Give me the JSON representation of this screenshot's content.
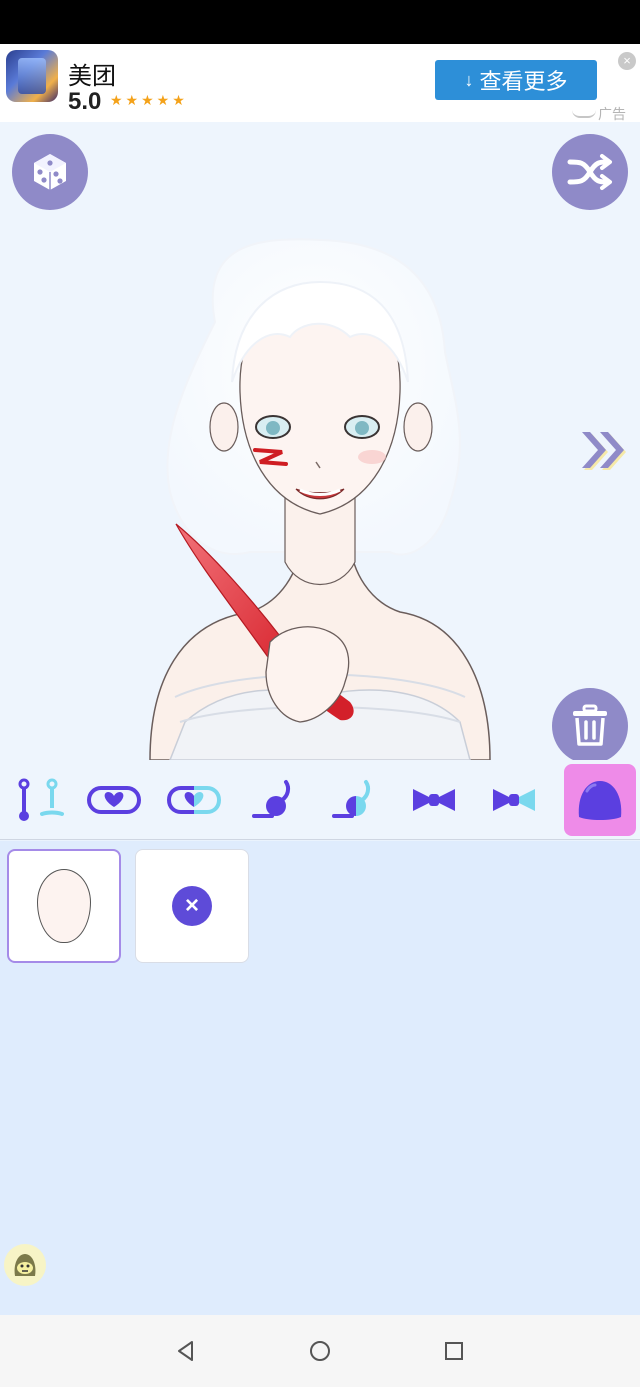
{
  "ad": {
    "app_name": "美团",
    "rating": "5.0",
    "stars": "★★★★★",
    "button_label": "查看更多",
    "download_glyph": "↓",
    "close_glyph": "×",
    "tag": "广告"
  },
  "icons": {
    "random": "dice-icon",
    "shuffle": "shuffle-icon",
    "next": "double-chevron-right-icon",
    "delete": "trash-icon"
  },
  "toolbar": {
    "items": [
      {
        "name": "piercing-tool",
        "active": false
      },
      {
        "name": "heart-band-tool",
        "active": false
      },
      {
        "name": "heart-band-half-tool",
        "active": false
      },
      {
        "name": "earring-tool",
        "active": false
      },
      {
        "name": "earring-half-tool",
        "active": false
      },
      {
        "name": "bow-tool",
        "active": false
      },
      {
        "name": "bow-half-tool",
        "active": false
      },
      {
        "name": "face-shape-tool",
        "active": true
      }
    ],
    "colors": {
      "accent": "#5b3fe0",
      "active_bg": "#ee8be8",
      "light": "#7ad8ee"
    }
  },
  "options": [
    {
      "name": "face-shape-option",
      "selected": true
    },
    {
      "name": "none-option",
      "selected": false,
      "glyph": "×"
    }
  ],
  "colors": {
    "round_button": "#8f8ac8",
    "ad_button": "#2d8fd8",
    "background": "#eaf3fd"
  }
}
